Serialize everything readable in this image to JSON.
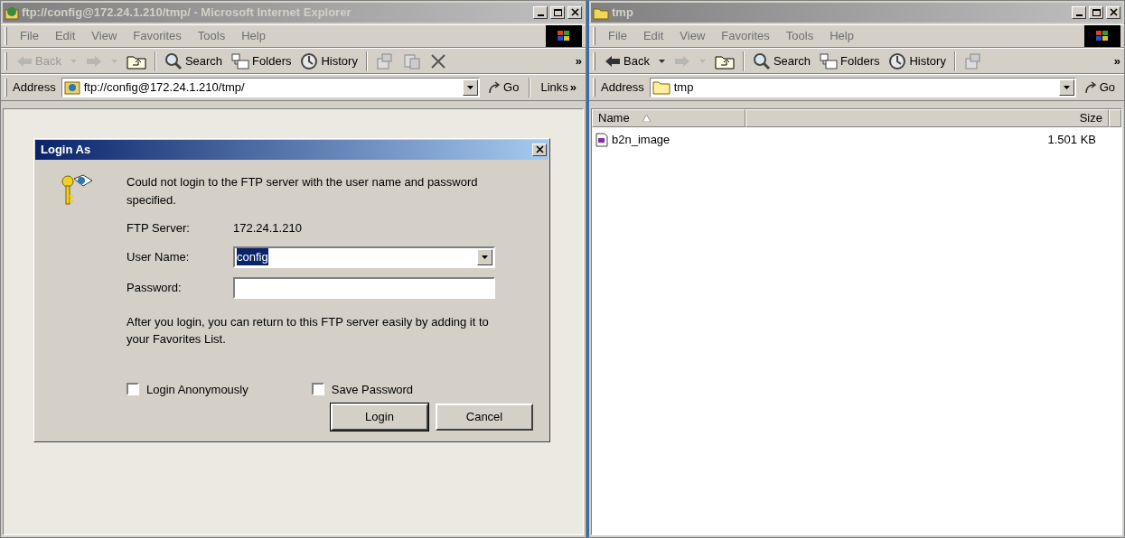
{
  "windows": [
    {
      "kind": "browser",
      "title": "ftp://config@172.24.1.210/tmp/ - Microsoft Internet Explorer",
      "active": false,
      "menu": [
        "File",
        "Edit",
        "View",
        "Favorites",
        "Tools",
        "Help"
      ],
      "toolbar": [
        {
          "kind": "back",
          "label": "Back",
          "disabled": true
        },
        {
          "kind": "dropdown",
          "disabled": true
        },
        {
          "kind": "forward",
          "disabled": true
        },
        {
          "kind": "dropdown",
          "disabled": true
        },
        {
          "kind": "up",
          "disabled": false
        },
        {
          "kind": "separator"
        },
        {
          "kind": "search",
          "label": "Search",
          "disabled": false
        },
        {
          "kind": "folders",
          "label": "Folders",
          "disabled": false
        },
        {
          "kind": "history",
          "label": "History",
          "disabled": false
        },
        {
          "kind": "separator"
        },
        {
          "kind": "moveto",
          "disabled": false
        },
        {
          "kind": "copyto",
          "disabled": false
        },
        {
          "kind": "delete",
          "disabled": false
        }
      ],
      "toolbar_overflow": "»",
      "address": {
        "label": "Address",
        "value": "ftp://config@172.24.1.210/tmp/",
        "go": "Go",
        "links": "Links",
        "links_overflow": "»"
      },
      "dialog": {
        "title": "Login As",
        "active": true,
        "message": "Could not login to the FTP server with the user name and password specified.",
        "server_label": "FTP Server:",
        "server_value": "172.24.1.210",
        "fields": [
          {
            "kind": "combo",
            "label": "User Name:",
            "value": "config",
            "text_selected": true
          },
          {
            "kind": "password",
            "label": "Password:"
          }
        ],
        "note": "After you login, you can return to this FTP server easily by adding it to your Favorites List.",
        "checkboxes": [
          {
            "label": "Login Anonymously",
            "checked": false
          },
          {
            "label": "Save Password",
            "checked": false
          }
        ],
        "buttons": [
          {
            "label": "Login",
            "default": true
          },
          {
            "label": "Cancel",
            "default": false
          }
        ]
      }
    },
    {
      "kind": "explorer",
      "title": "tmp",
      "active": false,
      "menu": [
        "File",
        "Edit",
        "View",
        "Favorites",
        "Tools",
        "Help"
      ],
      "toolbar": [
        {
          "kind": "back",
          "label": "Back",
          "disabled": false
        },
        {
          "kind": "dropdown",
          "disabled": false
        },
        {
          "kind": "forward",
          "disabled": true
        },
        {
          "kind": "dropdown",
          "disabled": true
        },
        {
          "kind": "up",
          "disabled": false
        },
        {
          "kind": "separator"
        },
        {
          "kind": "search",
          "label": "Search",
          "disabled": false
        },
        {
          "kind": "folders",
          "label": "Folders",
          "disabled": false
        },
        {
          "kind": "history",
          "label": "History",
          "disabled": false
        },
        {
          "kind": "separator"
        },
        {
          "kind": "moveto",
          "disabled": false
        }
      ],
      "toolbar_overflow": "»",
      "address": {
        "label": "Address",
        "value": "tmp",
        "go": "Go"
      },
      "list": {
        "columns": [
          {
            "label": "Name",
            "sorted": true
          },
          {
            "label": "Size",
            "sorted": false
          }
        ],
        "rows": [
          {
            "name": "b2n_image",
            "size": "1.501 KB",
            "selected": false
          }
        ]
      }
    }
  ]
}
